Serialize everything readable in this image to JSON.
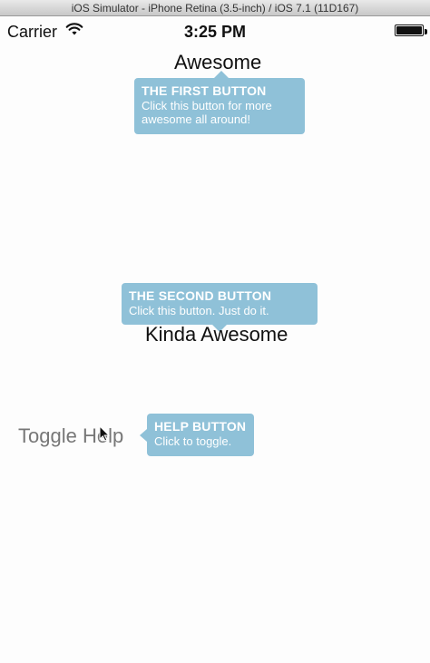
{
  "window": {
    "title": "iOS Simulator - iPhone Retina (3.5-inch) / iOS 7.1 (11D167)"
  },
  "status_bar": {
    "carrier": "Carrier",
    "time": "3:25 PM",
    "wifi_icon": "wifi-icon",
    "battery_icon": "battery-icon",
    "battery_level": 1.0
  },
  "buttons": {
    "awesome": "Awesome",
    "kinda_awesome": "Kinda Awesome",
    "toggle_help": "Toggle Help"
  },
  "tooltips": {
    "first": {
      "title": "THE FIRST BUTTON",
      "body": "Click this button for more awesome all around!"
    },
    "second": {
      "title": "THE SECOND BUTTON",
      "body": "Click this button. Just do it."
    },
    "help": {
      "title": "HELP BUTTON",
      "body": "Click to toggle."
    }
  },
  "colors": {
    "tooltip_background": "#8fc1d8",
    "tooltip_text": "#ffffff",
    "screen_background": "#fdfdfd"
  }
}
